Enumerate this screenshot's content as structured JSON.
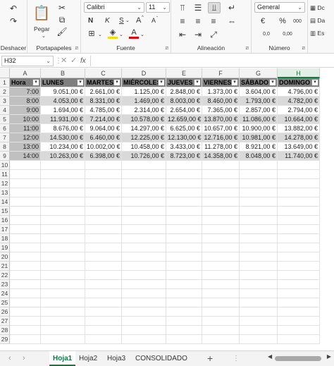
{
  "ribbon": {
    "undo_label": "Deshacer",
    "paste_label": "Pegar",
    "clipboard_label": "Portapapeles",
    "font_group_label": "Fuente",
    "font_name": "Calibri",
    "font_size": "11",
    "bold": "N",
    "italic": "K",
    "underline": "S",
    "grow_font": "A",
    "shrink_font": "A",
    "font_color_glyph": "A",
    "align_group_label": "Alineación",
    "number_group_label": "Número",
    "number_format": "General",
    "percent": "%",
    "thousands": "000",
    "currency_glyph": "€",
    "dec_inc": "0,0",
    "dec_dec": "0,00",
    "cond_format_partial": "Dc",
    "table_format_partial": "Da",
    "cell_styles_partial": "Es"
  },
  "formula_bar": {
    "name_box": "H32",
    "fx": "fx"
  },
  "sheet": {
    "columns": [
      "A",
      "B",
      "C",
      "D",
      "E",
      "F",
      "G",
      "H"
    ],
    "selected_column": "H",
    "row_numbers": [
      1,
      2,
      3,
      4,
      5,
      6,
      7,
      8,
      9,
      10,
      11,
      12,
      13,
      14,
      15,
      16,
      17,
      18,
      19,
      20,
      21,
      22,
      23,
      24,
      25,
      26,
      27,
      28,
      29
    ],
    "headers": [
      "Hora",
      "LUNES",
      "MARTES",
      "MIÉRCOLES",
      "JUEVES",
      "VIERNES",
      "SÁBADO",
      "DOMINGO"
    ],
    "rows": [
      [
        "7:00",
        "9.051,00 €",
        "2.661,00 €",
        "1.125,00 €",
        "2.848,00 €",
        "1.373,00 €",
        "3.604,00 €",
        "4.796,00 €"
      ],
      [
        "8:00",
        "4.053,00 €",
        "8.331,00 €",
        "1.469,00 €",
        "8.003,00 €",
        "8.460,00 €",
        "1.793,00 €",
        "4.782,00 €"
      ],
      [
        "9:00",
        "1.694,00 €",
        "4.785,00 €",
        "2.314,00 €",
        "2.654,00 €",
        "7.365,00 €",
        "2.857,00 €",
        "2.794,00 €"
      ],
      [
        "10:00",
        "11.931,00 €",
        "7.214,00 €",
        "10.578,00 €",
        "12.659,00 €",
        "13.870,00 €",
        "11.086,00 €",
        "10.664,00 €"
      ],
      [
        "11:00",
        "8.676,00 €",
        "9.064,00 €",
        "14.297,00 €",
        "6.625,00 €",
        "10.657,00 €",
        "10.900,00 €",
        "13.882,00 €"
      ],
      [
        "12:00",
        "14.530,00 €",
        "6.460,00 €",
        "12.225,00 €",
        "12.130,00 €",
        "12.716,00 €",
        "10.981,00 €",
        "14.278,00 €"
      ],
      [
        "13:00",
        "10.234,00 €",
        "10.002,00 €",
        "10.458,00 €",
        "3.433,00 €",
        "11.278,00 €",
        "8.921,00 €",
        "13.649,00 €"
      ],
      [
        "14:00",
        "10.263,00 €",
        "6.398,00 €",
        "10.726,00 €",
        "8.723,00 €",
        "14.358,00 €",
        "8.048,00 €",
        "11.740,00 €"
      ]
    ]
  },
  "tabs": [
    "Hoja1",
    "Hoja2",
    "Hoja3",
    "CONSOLIDADO"
  ],
  "active_tab": "Hoja1",
  "add_sheet": "+",
  "colors": {
    "accent": "#107c41",
    "header_fill": "#7f7f7f",
    "band_fill": "#d9d9d9",
    "hour_fill": "#c0c0c0"
  }
}
